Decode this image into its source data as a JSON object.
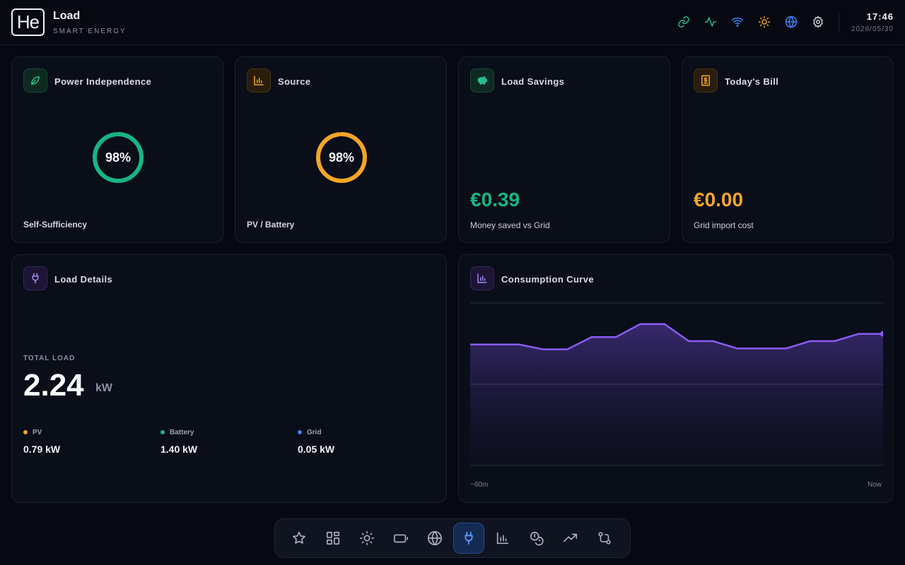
{
  "header": {
    "logo_text": "He",
    "title": "Load",
    "subtitle": "SMART ENERGY",
    "time": "17:46",
    "date": "2026/05/30",
    "status_icons": [
      {
        "name": "link-icon",
        "color": "#22c08a"
      },
      {
        "name": "activity-icon",
        "color": "#22c08a"
      },
      {
        "name": "wifi-icon",
        "color": "#3b82f6"
      },
      {
        "name": "sun-icon",
        "color": "#f5a524"
      },
      {
        "name": "globe-icon",
        "color": "#3b82f6"
      },
      {
        "name": "gear-icon",
        "color": "#c9ced8"
      }
    ]
  },
  "cards": {
    "independence": {
      "title": "Power Independence",
      "value_text": "98%",
      "value": 98,
      "footer": "Self-Sufficiency",
      "color": "#17b584"
    },
    "source": {
      "title": "Source",
      "value_text": "98%",
      "value": 98,
      "footer": "PV / Battery",
      "color": "#f5a524"
    },
    "savings": {
      "title": "Load Savings",
      "amount": "€0.39",
      "caption": "Money saved vs Grid",
      "color": "#17b584"
    },
    "bill": {
      "title": "Today's Bill",
      "amount": "€0.00",
      "caption": "Grid import cost",
      "color": "#f5a524"
    }
  },
  "load_details": {
    "title": "Load Details",
    "total_label": "TOTAL LOAD",
    "total_value": "2.24",
    "total_unit": "kW",
    "sources": [
      {
        "name": "PV",
        "value": "0.79 kW",
        "color": "#f5a524"
      },
      {
        "name": "Battery",
        "value": "1.40 kW",
        "color": "#17b584"
      },
      {
        "name": "Grid",
        "value": "0.05 kW",
        "color": "#3b82f6"
      }
    ]
  },
  "consumption": {
    "title": "Consumption Curve",
    "x_start_label": "~60m",
    "x_end_label": "Now",
    "color": "#8b5cf6"
  },
  "chart_data": {
    "type": "area",
    "title": "Consumption Curve",
    "x": [
      "~60m",
      "",
      "",
      "",
      "",
      "",
      "",
      "",
      "",
      "",
      "",
      "",
      "",
      "",
      "",
      "",
      "",
      "Now"
    ],
    "series": [
      {
        "values": [
          1.49,
          1.49,
          1.49,
          1.43,
          1.43,
          1.58,
          1.58,
          1.74,
          1.74,
          1.53,
          1.53,
          1.44,
          1.44,
          1.44,
          1.53,
          1.53,
          1.62,
          1.62
        ]
      }
    ],
    "ylim": [
      0,
      2
    ],
    "grid": true,
    "legend": "none"
  },
  "nav": {
    "items": [
      {
        "name": "favorites-nav",
        "icon": "star-icon"
      },
      {
        "name": "dashboard-nav",
        "icon": "grid-icon"
      },
      {
        "name": "solar-nav",
        "icon": "sun-icon"
      },
      {
        "name": "battery-nav",
        "icon": "battery-icon"
      },
      {
        "name": "grid-nav",
        "icon": "globe-icon"
      },
      {
        "name": "load-nav",
        "icon": "plug-icon",
        "active": true
      },
      {
        "name": "stats-nav",
        "icon": "bar-chart-icon"
      },
      {
        "name": "cost-nav",
        "icon": "coins-icon"
      },
      {
        "name": "trend-nav",
        "icon": "trending-up-icon"
      },
      {
        "name": "flow-nav",
        "icon": "git-compare-icon"
      }
    ]
  }
}
